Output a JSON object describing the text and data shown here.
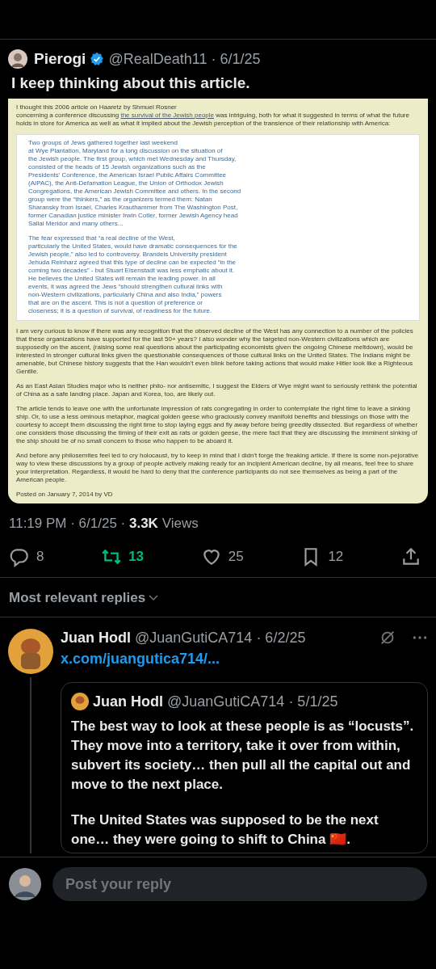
{
  "quoted_post": {
    "author": "Pierogi",
    "verified": true,
    "handle": "@RealDeath11",
    "date": "· 6/1/25",
    "text": "I keep thinking about this article.",
    "article": {
      "intro_line": "I thought this 2006 article on Haaretz by Shmuel Rosner",
      "intro": {
        "before": "concerning a conference discussing ",
        "link": "the survival of the Jewish people",
        "after": " was intriguing, both for what it suggested in terms of what the future holds in store for America as well as what it implied about the Jewish perception of the transience of their relationship with America:"
      },
      "quote": [
        [
          "Two groups of Jews gathered together last weekend",
          "at Wye Plantation, Maryland for a long discussion on the situation of",
          "the Jewish people. The first group, which met Wednesday and Thursday,",
          "consisted of the heads of 15 Jewish organizations such as the",
          "Presidents' Conference, the American Israel Public Affairs Committee",
          "(AIPAC), the Anti-Defamation League, the Union of Orthodox Jewish",
          "Congregations, the American Jewish Committee and others. In the second",
          "group were the “thinkers,” as the organizers termed them: Natan",
          "Sharansky from Israel, Charles Krauthammer from The Washington Post,",
          "former Canadian justice minister Irwin Cotler, former Jewish Agency head",
          "Sallai Meridor and many others..."
        ],
        [
          "The fear expressed that “a real decline of the West,",
          "particularly the United States, would have dramatic consequences for the",
          "Jewish people,” also led to controversy. Brandeis University president",
          "Jehuda Reinharz agreed that this type of decline can be expected “in the",
          "coming two decades” - but Stuart Eisenstadt was less emphatic about it.",
          "He believes the United States will remain the leading power. In all",
          "events, it was agreed the Jews “should strengthen cultural links with",
          "non-Western civilizations, particularly China and also India,” powers",
          "that are on the ascent. This is not a question of preference or",
          "closeness; it is a question of survival, of readiness for the future."
        ]
      ],
      "paragraphs": [
        "I am very curious to know if there was any recognition that the observed decline of the West has any connection to a number of the policies that these organizations have supported for the last 50+ years? I also wonder why the targeted non-Western civilizations which are supposedly on the ascent, (raising some real questions about the participating economists given the ongoing Chinese meltdown), would be interested in stronger cultural links given the questionable consequences of those cultural links on the United States. The Indians might be amenable, but Chinese history suggests that the Han wouldn't even blink before taking actions that would make Hitler look like a Righteous Gentile.",
        "As an East Asian Studies major who is neither philo- nor antisemitic, I suggest the Elders of Wye might want to seriously rethink the potential of China as a safe landing place. Japan and Korea, too, are likely out.",
        "The article tends to leave one with the unfortunate impression of rats congregating in order to contemplate the right time to leave a sinking ship. Or, to use a less ominous metaphor, magical golden geese who graciously convey manifold benefits and blessings on those with the courtesy to accept them discussing the right time to stop laying eggs and fly away before being greedily dissected. But regardless of whether one considers those discussing the timing of their exit as rats or golden geese, the mere fact that they are discussing the imminent sinking of the ship should be of no small concern to those who happen to be aboard it.",
        "And before any philosemites feel led to cry holocaust, try to keep in mind that I didn't forge the freaking article. If there is some non-pejorative way to view these discussions by a group of people actively making ready for an incipient American decline, by all means, feel free to share your interpretation. Regardless, it would be hard to deny that the conference participants do not see themselves as being a part of the American people."
      ],
      "posted": "Posted on January 7, 2014 by VD"
    }
  },
  "meta": {
    "time": "11:19 PM · 6/1/25 · ",
    "views_count": "3.3K",
    "views_label": " Views"
  },
  "actions": [
    {
      "kind": "reply",
      "count": "8",
      "active": false
    },
    {
      "kind": "repost",
      "count": "13",
      "active": true
    },
    {
      "kind": "like",
      "count": "25",
      "active": false
    },
    {
      "kind": "bookmark",
      "count": "12",
      "active": false
    },
    {
      "kind": "share"
    }
  ],
  "replies_sort": "Most relevant replies",
  "reply": {
    "author": "Juan Hodl",
    "handle": "@JuanGutiCA714",
    "date": "· 6/2/25",
    "link": "x.com/juangutica714/...",
    "quote": {
      "author": "Juan Hodl",
      "handle": "@JuanGutiCA714",
      "date": "· 5/1/25",
      "paragraphs": [
        "The best way to look at these people is as “locusts”.  They move into a territory, take it over from within, subvert its society… then pull all the capital out and move to the next place.",
        "The United States was supposed to be the next one… they were going to shift to China 🇨🇳."
      ]
    }
  },
  "composer": {
    "placeholder": "Post your reply"
  }
}
